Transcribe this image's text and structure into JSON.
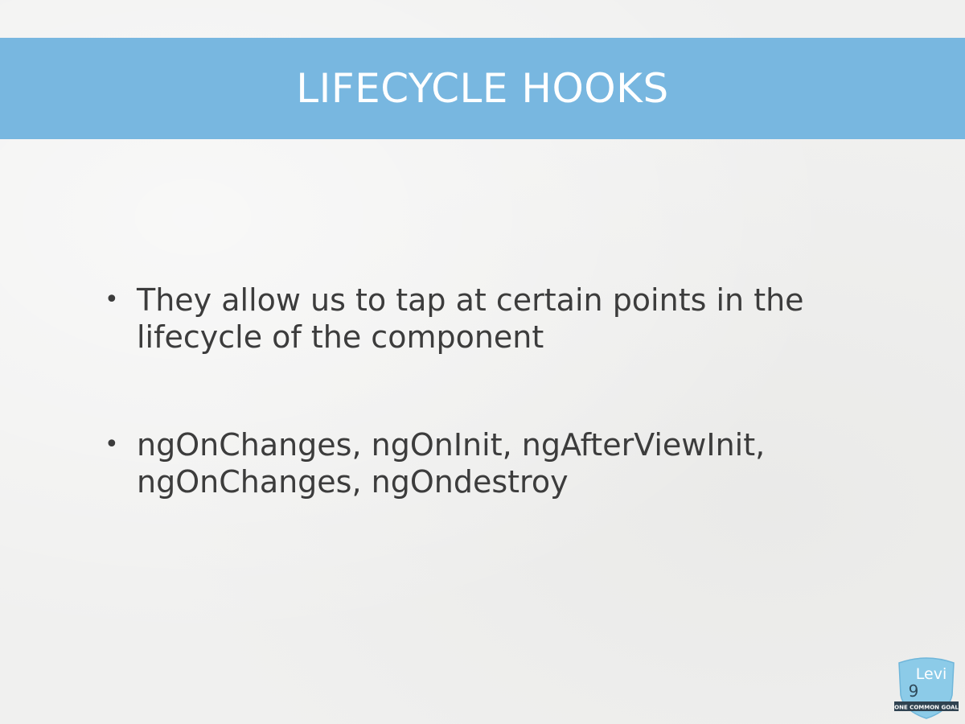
{
  "slide": {
    "title": "LIFECYCLE HOOKS",
    "bullets": [
      {
        "marker": "•",
        "text": "They allow us to tap at certain points in the lifecycle of the component"
      },
      {
        "marker": "•",
        "text": "ngOnChanges, ngOnInit, ngAfterViewInit, ngOnChanges, ngOndestroy"
      }
    ]
  },
  "logo": {
    "brand": "Levi",
    "mark": "9",
    "tagline": "ONE COMMON GOAL",
    "icon": "levi9-shield-logo-icon"
  },
  "colors": {
    "title_band": "#78b7e0",
    "title_text": "#ffffff",
    "body_text": "#3c3c3c",
    "background": "#f0f0ef"
  }
}
